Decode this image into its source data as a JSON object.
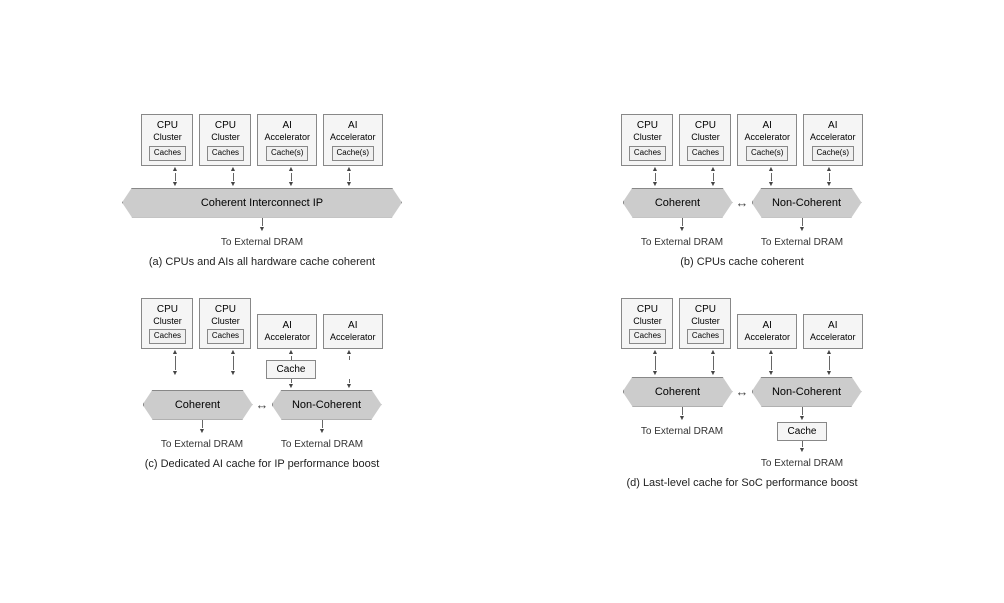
{
  "diagrams": [
    {
      "id": "a",
      "caption": "(a) CPUs and AIs all hardware cache coherent",
      "nodes": [
        {
          "title": "CPU",
          "sub": "Cluster",
          "cache": "Caches"
        },
        {
          "title": "CPU",
          "sub": "Cluster",
          "cache": "Caches"
        },
        {
          "title": "AI",
          "sub": "Accelerator",
          "cache": "Cache(s)"
        },
        {
          "title": "AI",
          "sub": "Accelerator",
          "cache": "Cache(s)"
        }
      ],
      "layout": "single-banner",
      "banner": "Coherent Interconnect IP",
      "dram": [
        "To External DRAM"
      ]
    },
    {
      "id": "b",
      "caption": "(b) CPUs cache coherent",
      "nodes": [
        {
          "title": "CPU",
          "sub": "Cluster",
          "cache": "Caches"
        },
        {
          "title": "CPU",
          "sub": "Cluster",
          "cache": "Caches"
        },
        {
          "title": "AI",
          "sub": "Accelerator",
          "cache": "Cache(s)"
        },
        {
          "title": "AI",
          "sub": "Accelerator",
          "cache": "Cache(s)"
        }
      ],
      "layout": "dual-banner",
      "banner_left": "Coherent",
      "banner_right": "Non-Coherent",
      "dram_left": "To External DRAM",
      "dram_right": "To External DRAM"
    },
    {
      "id": "c",
      "caption": "(c) Dedicated AI cache for IP performance boost",
      "nodes": [
        {
          "title": "CPU",
          "sub": "Cluster",
          "cache": "Caches"
        },
        {
          "title": "CPU",
          "sub": "Cluster",
          "cache": "Caches"
        },
        {
          "title": "AI",
          "sub": "Accelerator",
          "cache": null
        },
        {
          "title": "AI",
          "sub": "Accelerator",
          "cache": null
        }
      ],
      "layout": "dual-banner-with-cache",
      "banner_left": "Coherent",
      "banner_right": "Non-Coherent",
      "mid_cache": "Cache",
      "dram_left": "To External DRAM",
      "dram_right": "To External DRAM"
    },
    {
      "id": "d",
      "caption": "(d) Last-level cache for SoC performance boost",
      "nodes": [
        {
          "title": "CPU",
          "sub": "Cluster",
          "cache": "Caches"
        },
        {
          "title": "CPU",
          "sub": "Cluster",
          "cache": "Caches"
        },
        {
          "title": "AI",
          "sub": "Accelerator",
          "cache": null
        },
        {
          "title": "AI",
          "sub": "Accelerator",
          "cache": null
        }
      ],
      "layout": "dual-banner-bottom-cache",
      "banner_left": "Coherent",
      "banner_right": "Non-Coherent",
      "bottom_cache": "Cache",
      "dram_left": "To External DRAM",
      "dram_right": "To External DRAM"
    }
  ]
}
